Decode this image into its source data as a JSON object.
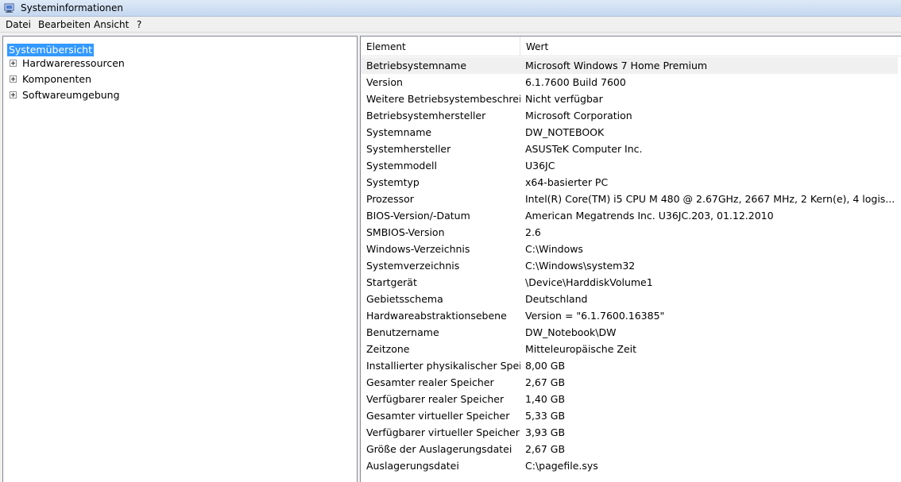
{
  "window": {
    "title": "Systeminformationen",
    "icon": "system-info-icon"
  },
  "menu": [
    {
      "label": "Datei"
    },
    {
      "label": "Bearbeiten"
    },
    {
      "label": "Ansicht"
    },
    {
      "label": "?"
    }
  ],
  "tree": {
    "root": "Systemübersicht",
    "nodes": [
      {
        "label": "Hardwareressourcen",
        "expander": "plus-icon"
      },
      {
        "label": "Komponenten",
        "expander": "plus-icon"
      },
      {
        "label": "Softwareumgebung",
        "expander": "plus-icon"
      }
    ]
  },
  "list": {
    "columns": [
      "Element",
      "Wert"
    ],
    "selected_row": 0,
    "rows": [
      {
        "element": "Betriebsystemname",
        "value": "Microsoft Windows 7 Home Premium"
      },
      {
        "element": "Version",
        "value": "6.1.7600 Build 7600"
      },
      {
        "element": "Weitere Betriebsystembeschrei...",
        "value": "Nicht verfügbar"
      },
      {
        "element": "Betriebsystemhersteller",
        "value": "Microsoft Corporation"
      },
      {
        "element": "Systemname",
        "value": "DW_NOTEBOOK"
      },
      {
        "element": "Systemhersteller",
        "value": "ASUSTeK Computer Inc."
      },
      {
        "element": "Systemmodell",
        "value": "U36JC"
      },
      {
        "element": "Systemtyp",
        "value": "x64-basierter PC"
      },
      {
        "element": "Prozessor",
        "value": "Intel(R) Core(TM) i5 CPU       M 480  @ 2.67GHz, 2667 MHz, 2 Kern(e), 4 logis..."
      },
      {
        "element": "BIOS-Version/-Datum",
        "value": "American Megatrends Inc. U36JC.203, 01.12.2010"
      },
      {
        "element": "SMBIOS-Version",
        "value": "2.6"
      },
      {
        "element": "Windows-Verzeichnis",
        "value": "C:\\Windows"
      },
      {
        "element": "Systemverzeichnis",
        "value": "C:\\Windows\\system32"
      },
      {
        "element": "Startgerät",
        "value": "\\Device\\HarddiskVolume1"
      },
      {
        "element": "Gebietsschema",
        "value": "Deutschland"
      },
      {
        "element": "Hardwareabstraktionsebene",
        "value": "Version = \"6.1.7600.16385\""
      },
      {
        "element": "Benutzername",
        "value": "DW_Notebook\\DW"
      },
      {
        "element": "Zeitzone",
        "value": "Mitteleuropäische Zeit"
      },
      {
        "element": "Installierter physikalischer Speic...",
        "value": "8,00 GB"
      },
      {
        "element": "Gesamter realer Speicher",
        "value": "2,67 GB"
      },
      {
        "element": "Verfügbarer realer Speicher",
        "value": "1,40 GB"
      },
      {
        "element": "Gesamter virtueller Speicher",
        "value": "5,33 GB"
      },
      {
        "element": "Verfügbarer virtueller Speicher",
        "value": "3,93 GB"
      },
      {
        "element": "Größe der Auslagerungsdatei",
        "value": "2,67 GB"
      },
      {
        "element": "Auslagerungsdatei",
        "value": "C:\\pagefile.sys"
      }
    ]
  }
}
